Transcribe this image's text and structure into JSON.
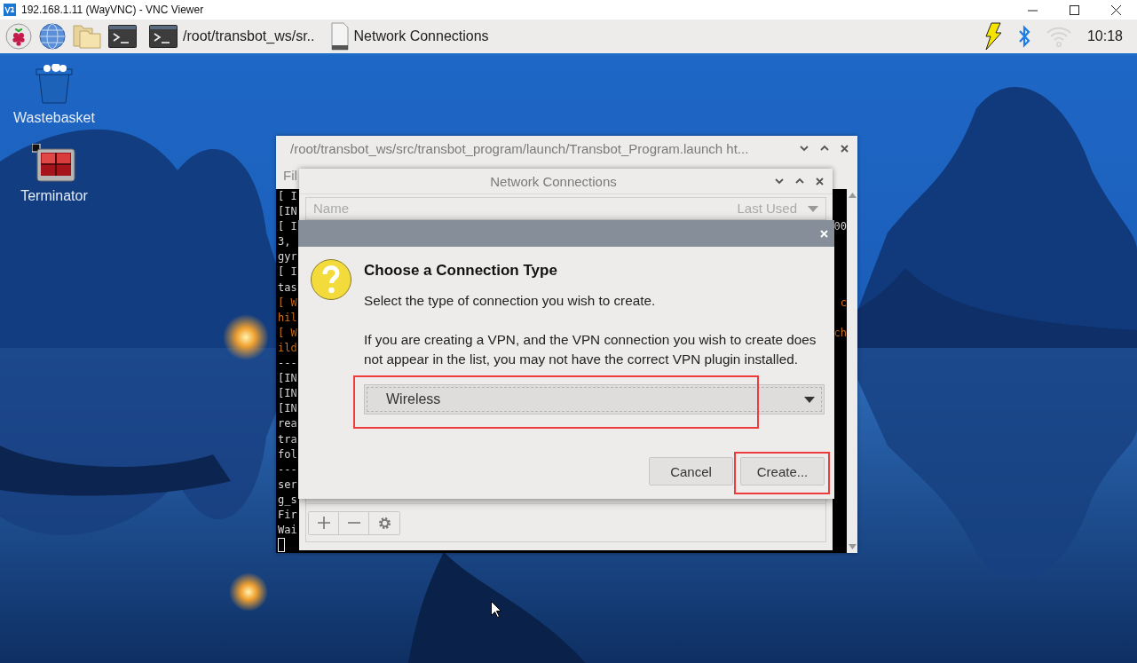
{
  "viewer": {
    "title": "192.168.1.11 (WayVNC) - VNC Viewer"
  },
  "taskbar": {
    "tasks": [
      {
        "kind": "terminal",
        "label": "/root/transbot_ws/sr.."
      },
      {
        "kind": "document",
        "label": "Network Connections"
      }
    ],
    "wifi_connected": false,
    "clock": "10:18"
  },
  "desktop_icons": [
    {
      "kind": "trash",
      "label": "Wastebasket"
    },
    {
      "kind": "terminal",
      "label": "Terminator"
    }
  ],
  "terminal_window": {
    "title": "/root/transbot_ws/src/transbot_program/launch/Transbot_Program.launch ht...",
    "menu": "Fil",
    "lines": [
      {
        "kind": "info",
        "start": "[ I"
      },
      {
        "kind": "info",
        "start": "[IN"
      },
      {
        "kind": "info",
        "start": "[ I",
        "end": "00"
      },
      {
        "kind": "info",
        "start": "3,"
      },
      {
        "kind": "info",
        "start": "gyr"
      },
      {
        "kind": "info",
        "start": "[ I"
      },
      {
        "kind": "info",
        "start": "tas"
      },
      {
        "kind": "warn",
        "start": "[ W",
        "end": "c"
      },
      {
        "kind": "warn",
        "start": "hil"
      },
      {
        "kind": "warn",
        "start": "[ W",
        "end": "ch"
      },
      {
        "kind": "warn",
        "start": "ild"
      },
      {
        "kind": "info",
        "start": "---"
      },
      {
        "kind": "info",
        "start": "[IN"
      },
      {
        "kind": "info",
        "start": "[IN"
      },
      {
        "kind": "info",
        "start": "[IN"
      },
      {
        "kind": "info",
        "start": "rea"
      },
      {
        "kind": "info",
        "start": "tra"
      },
      {
        "kind": "info",
        "start": "fol"
      },
      {
        "kind": "info",
        "start": "---"
      },
      {
        "kind": "info",
        "start": "ser"
      },
      {
        "kind": "info",
        "start": "g_s"
      },
      {
        "kind": "info",
        "start": "Fir"
      },
      {
        "kind": "info",
        "start": "Wai"
      }
    ]
  },
  "network_window": {
    "title": "Network Connections",
    "columns": [
      "Name",
      "Last Used"
    ]
  },
  "dialog": {
    "heading": "Choose a Connection Type",
    "message": "Select the type of connection you wish to create.",
    "note": "If you are creating a VPN, and the VPN connection you wish to create does not appear in the list, you may not have the correct VPN plugin installed.",
    "connection_type": {
      "value": "Wireless",
      "highlighted": true
    },
    "buttons": [
      {
        "label": "Cancel",
        "highlighted": false
      },
      {
        "label": "Create...",
        "highlighted": true
      }
    ]
  }
}
